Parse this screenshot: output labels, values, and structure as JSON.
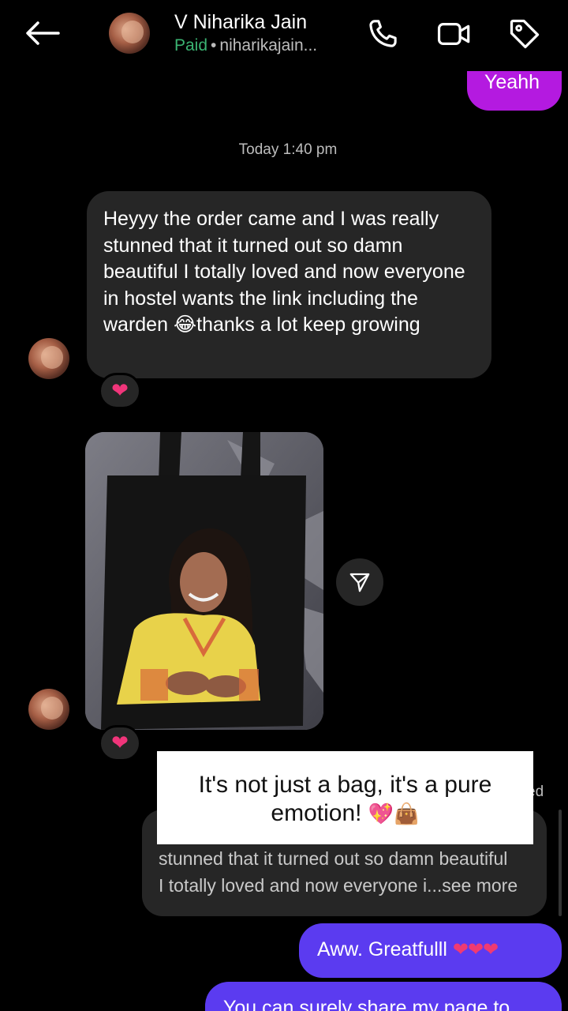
{
  "header": {
    "contact_name": "V Niharika Jain",
    "paid_label": "Paid",
    "separator": "•",
    "handle": "niharikajain...",
    "icons": {
      "back": "arrow-left-icon",
      "call": "phone-icon",
      "video": "video-camera-icon",
      "tag": "tag-icon"
    }
  },
  "messages": {
    "outgoing_top": "Yeahh",
    "timestamp": "Today 1:40 pm",
    "incoming_1": "Heyyy the order came and I was really stunned that it turned out so damn beautiful I totally loved and now everyone in hostel wants the link including the warden 😂thanks a lot keep growing",
    "reaction_1": "❤",
    "reaction_2": "❤",
    "replied_label": "ed",
    "reply_line_1": "stunned that it turned out so damn beautiful",
    "reply_line_2": "I totally loved and now everyone i...see more",
    "outgoing_aww_text": "Aww. Greatfulll ",
    "outgoing_aww_hearts": "❤❤❤",
    "outgoing_share": "You can surely share my page to"
  },
  "overlay": {
    "line_1": "It's not just a bag, it's a pure",
    "line_2": "emotion! ",
    "emoji": "💖👜"
  },
  "colors": {
    "outgoing_purple": "#b41ae0",
    "outgoing_blue": "#5b3bf0",
    "incoming_bubble": "#262626",
    "paid_green": "#3bb372",
    "reaction_heart": "#f0357a"
  }
}
